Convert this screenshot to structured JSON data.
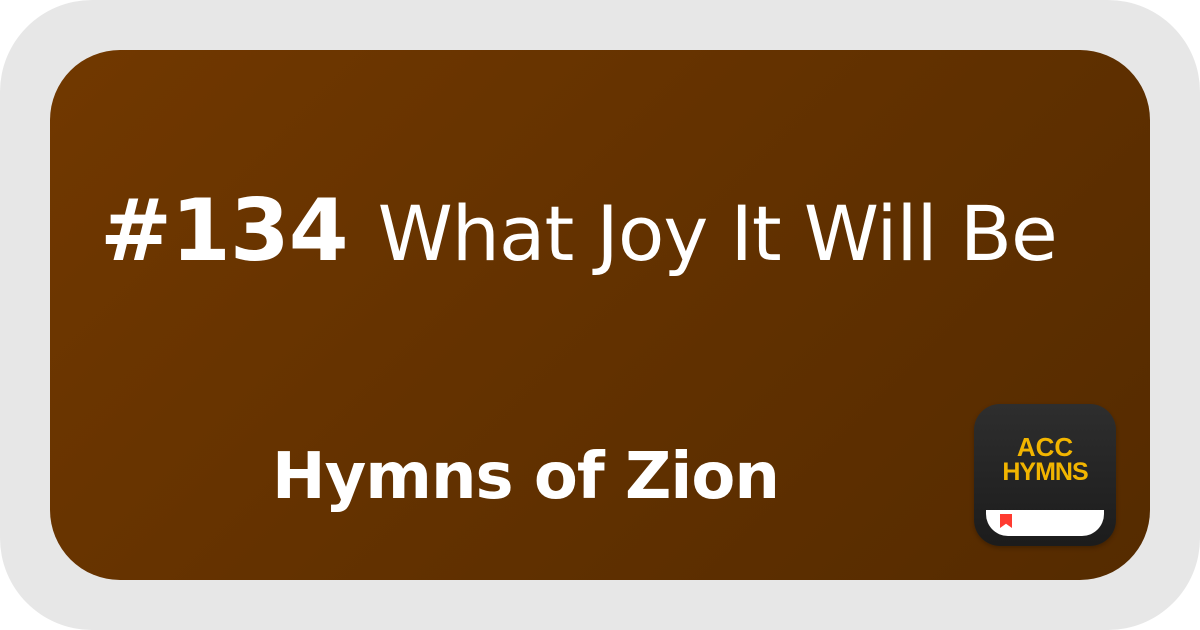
{
  "card": {
    "hymn_number": "#134",
    "hymn_title": "What Joy It Will Be",
    "hymnal_name": "Hymns of Zion"
  },
  "app_icon": {
    "line1": "ACC",
    "line2": "HYMNS",
    "icon": "book-icon",
    "ribbon_color": "#ff3b30",
    "text_color": "#f2b500"
  },
  "colors": {
    "frame": "#e7e7e7",
    "card_start": "#713800",
    "card_end": "#552b00",
    "text": "#ffffff"
  }
}
